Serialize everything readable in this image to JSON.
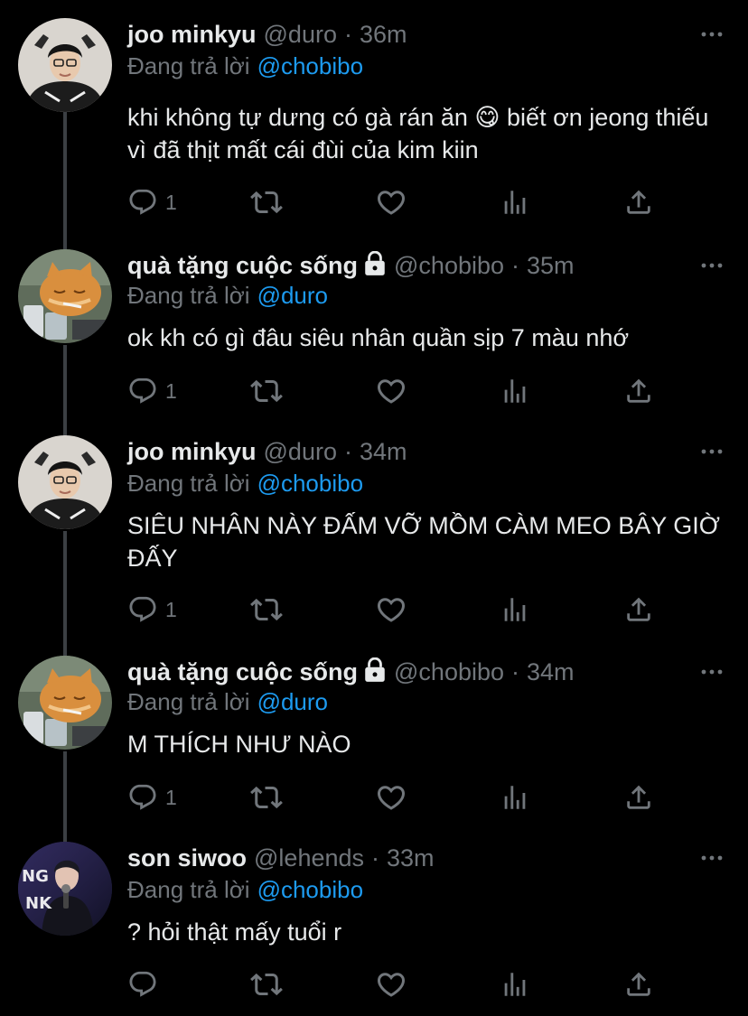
{
  "colors": {
    "background": "#000000",
    "primary_text": "#e7e9ea",
    "secondary_text": "#71767b",
    "link": "#1d9bf0",
    "thread_line": "#3b3f43"
  },
  "reply_prefix": "Đang trả lời",
  "tweets": [
    {
      "name": "joo minkyu",
      "handle": "@duro",
      "time": "36m",
      "reply_to": "@chobibo",
      "text": "khi không tự dưng có gà rán ăn 😋  biết ơn jeong thiếu vì đã thịt mất cái đùi của kim kiin",
      "reply_count": "1"
    },
    {
      "name": "quà tặng cuộc sống",
      "handle": "@chobibo",
      "time": "35m",
      "reply_to": "@duro",
      "text": "ok kh có gì đâu siêu nhân quần sịp 7 màu nhớ",
      "reply_count": "1"
    },
    {
      "name": "joo minkyu",
      "handle": "@duro",
      "time": "34m",
      "reply_to": "@chobibo",
      "text": "SIÊU NHÂN NÀY ĐẤM VỠ MỒM CÀM MEO BÂY GIỜ ĐẤY",
      "reply_count": "1"
    },
    {
      "name": "quà tặng cuộc sống",
      "handle": "@chobibo",
      "time": "34m",
      "reply_to": "@duro",
      "text": "M THÍCH NHƯ NÀO",
      "reply_count": "1"
    },
    {
      "name": "son siwoo",
      "handle": "@lehends",
      "time": "33m",
      "reply_to": "@chobibo",
      "text": "? hỏi thật mấy tuổi r",
      "reply_count": ""
    }
  ],
  "dot_separator": "·",
  "avatar_badge_text": "NG NK"
}
